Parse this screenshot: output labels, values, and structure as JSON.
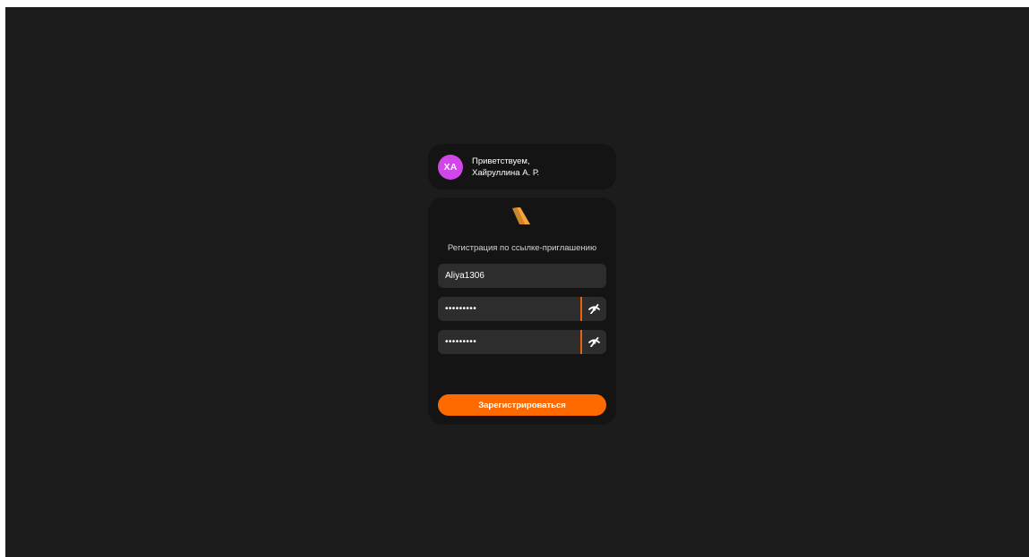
{
  "greeting": {
    "avatar_initials": "ХА",
    "line1": "Приветствуем,",
    "line2": "Хайруллина А. Р.",
    "avatar_color": "#d046e8"
  },
  "form": {
    "logo_icon": "brand-logo-icon",
    "title": "Регистрация по ссылке-приглашению",
    "login_value": "Aliya1306",
    "password_value": "•••••••••",
    "password_confirm_value": "•••••••••",
    "toggle_icon": "eye-off-icon",
    "submit_label": "Зарегистрироваться",
    "accent_color": "#ff6a00"
  }
}
